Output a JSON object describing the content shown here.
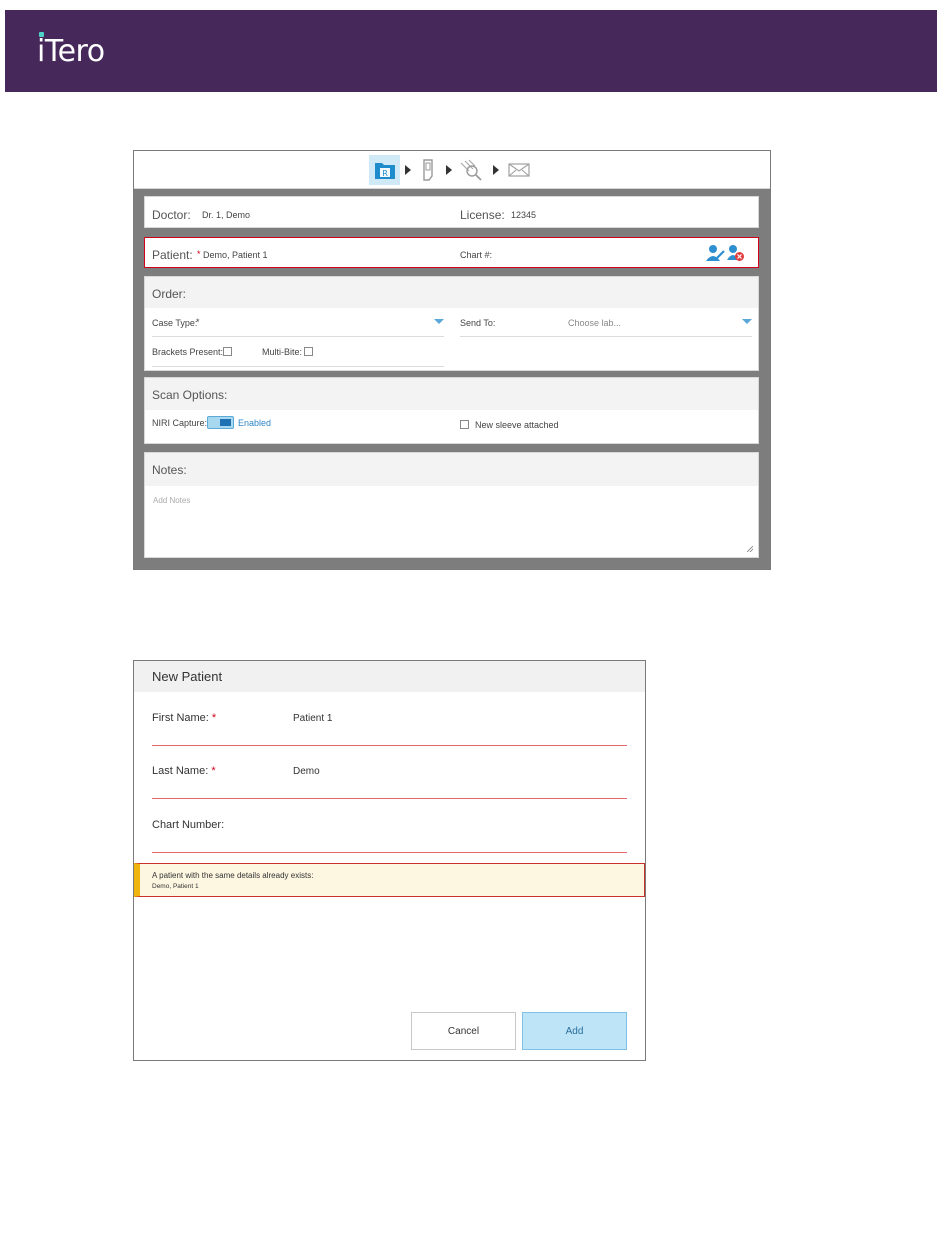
{
  "brand": {
    "logo_text": "iTero",
    "color": "#46295a"
  },
  "rx_form": {
    "workflow": {
      "steps": [
        "rx-icon",
        "scan-icon",
        "view-icon",
        "send-icon"
      ],
      "active_step": "rx-icon"
    },
    "doctor": {
      "label": "Doctor:",
      "value": "Dr. 1, Demo"
    },
    "license": {
      "label": "License:",
      "value": "12345"
    },
    "patient": {
      "label": "Patient:",
      "required_mark": "*",
      "value": "Demo, Patient 1"
    },
    "chart": {
      "label": "Chart #:"
    },
    "patient_icons": [
      "edit-patient-icon",
      "remove-patient-icon"
    ],
    "order": {
      "title": "Order:",
      "case_type_label": "Case Type:",
      "case_type_required": "*",
      "send_to_label": "Send To:",
      "send_to_placeholder": "Choose lab...",
      "brackets_label": "Brackets Present:",
      "multibite_label": "Multi-Bite:"
    },
    "scan_options": {
      "title": "Scan Options:",
      "niri_label": "NIRI Capture:",
      "niri_state": "Enabled",
      "sleeve_label": "New sleeve attached"
    },
    "notes": {
      "title": "Notes:",
      "placeholder": "Add Notes"
    }
  },
  "new_patient": {
    "title": "New Patient",
    "first_name_label": "First Name:",
    "first_name_value": "Patient 1",
    "last_name_label": "Last Name:",
    "last_name_value": "Demo",
    "required_mark": "*",
    "chart_label": "Chart Number:",
    "warning_message": "A patient with the same details already exists:",
    "warning_name": "Demo, Patient 1",
    "cancel_label": "Cancel",
    "add_label": "Add"
  }
}
